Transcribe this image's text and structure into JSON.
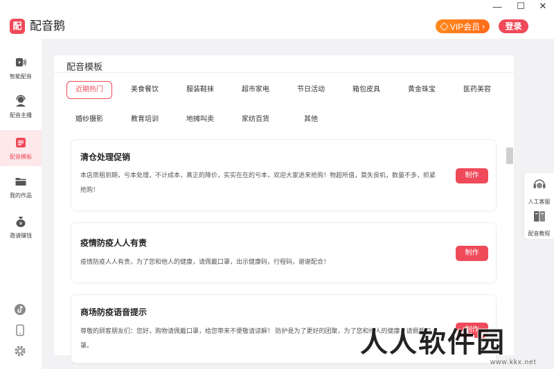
{
  "app": {
    "logo_char": "配",
    "title": "配音鹅"
  },
  "window": {
    "minimize": "—",
    "maximize": "☐",
    "close": "✕"
  },
  "header": {
    "vip_label": "VIP会员",
    "vip_arrow": "›",
    "login_label": "登录"
  },
  "nav": {
    "items": [
      {
        "label": "智能配音",
        "icon": "speaker-icon"
      },
      {
        "label": "配音主播",
        "icon": "headset-icon"
      },
      {
        "label": "配音模板",
        "icon": "template-icon",
        "active": true
      },
      {
        "label": "我的作品",
        "icon": "folder-icon"
      },
      {
        "label": "邀请赚钱",
        "icon": "money-bag-icon"
      }
    ],
    "bottom_icons": [
      "tiktok-icon",
      "phone-icon",
      "settings-icon"
    ]
  },
  "panel": {
    "title": "配音模板",
    "categories": [
      {
        "label": "近期热门",
        "active": true
      },
      {
        "label": "美食餐饮"
      },
      {
        "label": "服装鞋袜"
      },
      {
        "label": "超市家电"
      },
      {
        "label": "节日活动"
      },
      {
        "label": "箱包皮具"
      },
      {
        "label": "黄金珠宝"
      },
      {
        "label": "医药美容"
      },
      {
        "label": "婚纱摄影"
      },
      {
        "label": "教育培训"
      },
      {
        "label": "地摊叫卖"
      },
      {
        "label": "家纺百货"
      },
      {
        "label": "其他"
      }
    ],
    "cards": [
      {
        "title": "清仓处理促销",
        "desc": "本店房租到期，亏本处理，不计成本，真正的降价，实实在在的亏本，欢迎大家进来抢购！物超所值，莫失良机，数量不多，抓紧抢购！",
        "button": "制作"
      },
      {
        "title": "疫情防疫人人有责",
        "desc": "疫情防疫人人有责，为了您和他人的健康，请佩戴口罩，出示健康码，行程码，谢谢配合！",
        "button": "制作"
      },
      {
        "title": "商场防疫语音提示",
        "desc": "尊敬的顾客朋友们：您好，购物请佩戴口罩，给您带来不便敬请谅解！ 防护是为了更好的团聚，为了您和他人的健康，请佩戴口罩。",
        "button": "制作"
      }
    ]
  },
  "right_panel": {
    "items": [
      {
        "label": "人工客服",
        "icon": "service-icon"
      },
      {
        "label": "配音教程",
        "icon": "book-icon"
      }
    ]
  },
  "watermark": {
    "text": "人人软件园",
    "url": "www.kkx.net"
  },
  "colors": {
    "accent": "#ef4a59",
    "vip": "#ff7a1e",
    "background": "#f2f2f4"
  }
}
